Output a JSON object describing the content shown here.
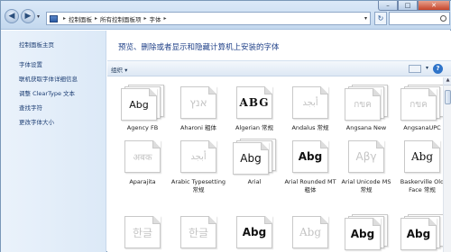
{
  "address": {
    "crumbs": [
      "控制面板",
      "所有控制面板项",
      "字体"
    ]
  },
  "sidebar": {
    "home": "控制面板主页",
    "links": [
      "字体设置",
      "联机获取字体详细信息",
      "调整 ClearType 文本",
      "查找字符",
      "更改字体大小"
    ]
  },
  "main": {
    "title": "预览、删除或者显示和隐藏计算机上安装的字体",
    "toolbar": {
      "organize": "组织 ▾"
    },
    "fonts": [
      {
        "name": "Agency FB",
        "glyph": "Abg"
      },
      {
        "name": "Aharoni 粗体",
        "glyph": "אנץ"
      },
      {
        "name": "Algerian 常规",
        "glyph": "ABG"
      },
      {
        "name": "Andalus 常规",
        "glyph": "أبجد"
      },
      {
        "name": "Angsana New",
        "glyph": "กขค"
      },
      {
        "name": "AngsanaUPC",
        "glyph": "กขค"
      },
      {
        "name": "Aparajita",
        "glyph": "अबक"
      },
      {
        "name": "Arabic Typesetting 常规",
        "glyph": "أبجد"
      },
      {
        "name": "Arial",
        "glyph": "Abg"
      },
      {
        "name": "Arial Rounded MT 粗体",
        "glyph": "Abg"
      },
      {
        "name": "Arial Unicode MS 常规",
        "glyph": "Αβγ"
      },
      {
        "name": "Baskerville Old Face 常规",
        "glyph": "Abg"
      },
      {
        "name": "",
        "glyph": "한글"
      },
      {
        "name": "",
        "glyph": "한글"
      },
      {
        "name": "",
        "glyph": "Abg"
      },
      {
        "name": "",
        "glyph": "Abg"
      },
      {
        "name": "",
        "glyph": "Abg"
      },
      {
        "name": "",
        "glyph": "Abg"
      }
    ]
  }
}
